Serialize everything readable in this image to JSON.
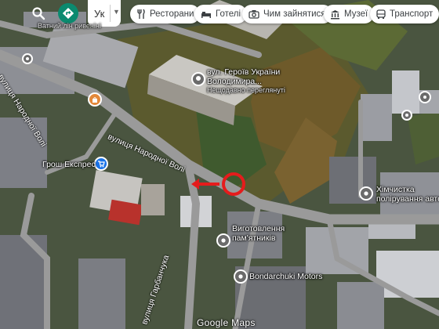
{
  "toolbar": {
    "language": "Ук",
    "chips": [
      {
        "label": "Ресторани",
        "icon": "fork-knife-icon"
      },
      {
        "label": "Готелі",
        "icon": "bed-icon"
      },
      {
        "label": "Чим зайнятися",
        "icon": "camera-icon"
      },
      {
        "label": "Музеї",
        "icon": "museum-icon"
      },
      {
        "label": "Транспорт",
        "icon": "bus-icon"
      }
    ]
  },
  "places": {
    "landmark_line1": "вул. Героїв України",
    "landmark_line2": "Володимира...",
    "landmark_note": "Нещодавно переглянуті",
    "cash_point": "Грош Експрес",
    "dry_cleaning_line1": "Хімчистка",
    "dry_cleaning_line2": "полірування авто",
    "monument_line1": "Виготовлення",
    "monument_line2": "пам'ятників",
    "motors": "Bondarchuki Motors",
    "top_partial": "Ватний лін ривеніні"
  },
  "roads": {
    "narodnoi_voli_main": "вулиця Народної Волі",
    "narodnoi_voli_left": "вулиця Народної Волі",
    "garbanchuka": "вулиця Гарбанчука"
  },
  "logo": "Google Maps",
  "colors": {
    "road": "#9a9a9a",
    "pin_green": "#2e7d5b",
    "pin_orange": "#e3883a",
    "pin_blue": "#1a73e8",
    "pin_grey": "#6b6b6b",
    "marker_red": "#e51c1c"
  }
}
